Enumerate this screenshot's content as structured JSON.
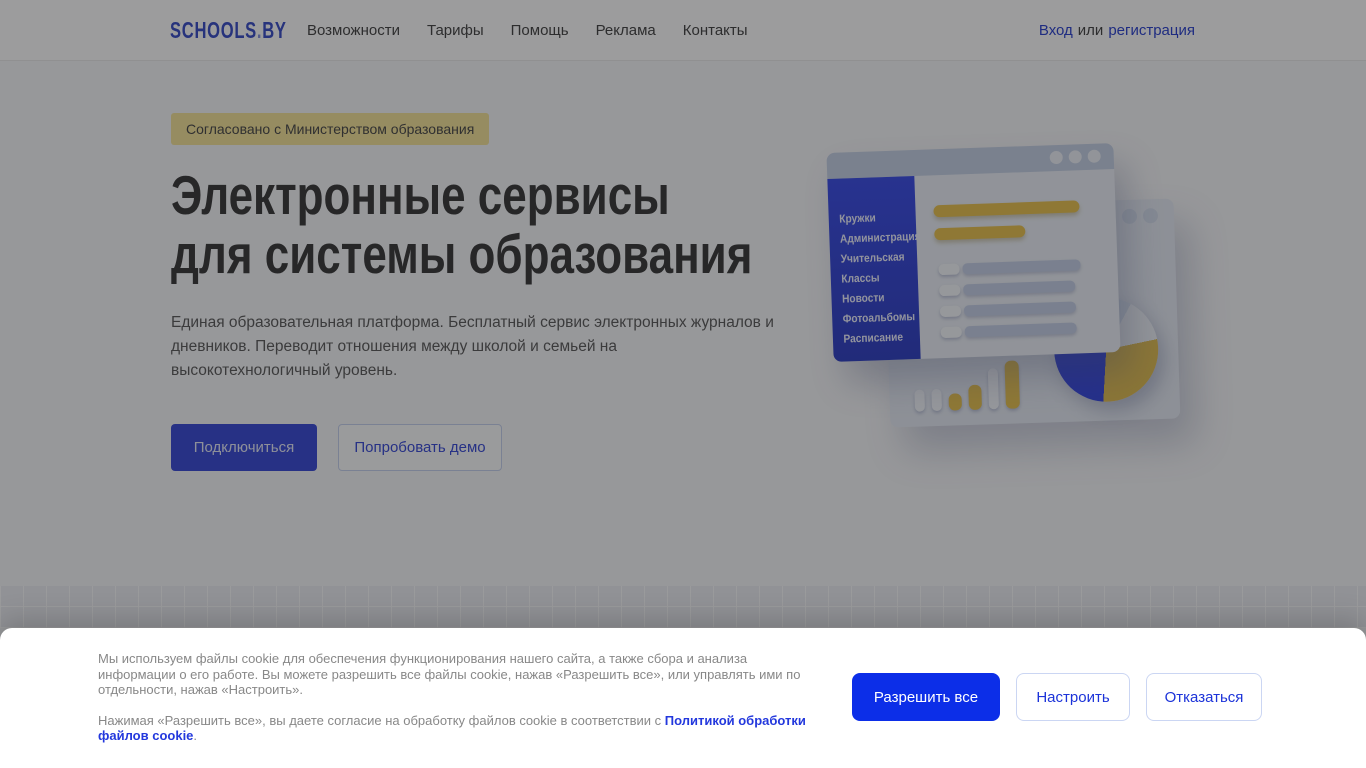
{
  "colors": {
    "brand_blue": "#3c4ed8",
    "logo_blue": "#3d50c9",
    "badge_yellow": "#f5e49b",
    "sidebar_blue": "#3b4ce4",
    "accent_yellow": "#e9c453",
    "cookie_allow_blue": "#0c2ee8",
    "link_blue": "#2f45d0",
    "pie_blue": "#3a4be0"
  },
  "header": {
    "logo": {
      "part1": "SCHOOLS",
      "dot": ".",
      "part2": "BY"
    },
    "nav": [
      "Возможности",
      "Тарифы",
      "Помощь",
      "Реклама",
      "Контакты"
    ],
    "auth": {
      "login": "Вход",
      "separator": "или",
      "register": "регистрация"
    }
  },
  "hero": {
    "badge": "Согласовано с Министерством образования",
    "title_line1": "Электронные сервисы",
    "title_line2": "для системы образования",
    "description": "Единая образовательная платформа. Бесплатный сервис электронных журналов и дневников. Переводит отношения между школой и семьей на высокотехнологичный уровень.",
    "primary_button": "Подключиться",
    "secondary_button": "Попробовать демо"
  },
  "illustration": {
    "menu_items": [
      "Кружки",
      "Администрация",
      "Учительская",
      "Классы",
      "Новости",
      "Фотоальбомы",
      "Расписание"
    ]
  },
  "cookie_banner": {
    "paragraph1": "Мы используем файлы cookie для обеспечения функционирования нашего сайта, а также сбора и анализа информации о его работе. Вы можете разрешить все файлы cookie, нажав «Разрешить все», или управлять ими по отдельности, нажав «Настроить».",
    "paragraph2_prefix": "Нажимая «Разрешить все», вы даете согласие на обработку файлов cookie в соответствии с ",
    "paragraph2_link": "Политикой обработки файлов cookie",
    "paragraph2_suffix": ".",
    "allow_button": "Разрешить все",
    "configure_button": "Настроить",
    "decline_button": "Отказаться"
  }
}
